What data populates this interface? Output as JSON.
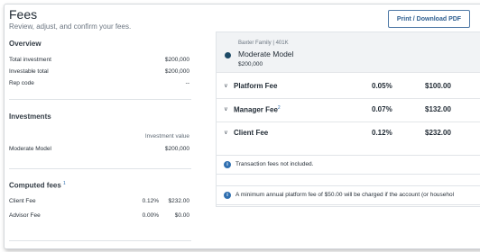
{
  "header": {
    "title": "Fees",
    "subtitle": "Review, adjust, and confirm your fees.",
    "print_label": "Print / Download PDF"
  },
  "overview": {
    "title": "Overview",
    "rows": [
      {
        "label": "Total investment",
        "value": "$200,000"
      },
      {
        "label": "Investable total",
        "value": "$200,000"
      },
      {
        "label": "Rep code",
        "value": "--"
      }
    ]
  },
  "investments": {
    "title": "Investments",
    "column_header": "Investment value",
    "rows": [
      {
        "label": "Moderate Model",
        "value": "$200,000"
      }
    ]
  },
  "computed_fees": {
    "title": "Computed fees",
    "footnote": "1",
    "rows": [
      {
        "label": "Client Fee",
        "pct": "0.12%",
        "value": "$232.00"
      },
      {
        "label": "Advisor Fee",
        "pct": "0.00%",
        "value": "$0.00"
      }
    ]
  },
  "model_card": {
    "account": "Baxter Family | 401K",
    "name": "Moderate Model",
    "amount": "$200,000",
    "dot_color": "#1d4a66",
    "fees": [
      {
        "name": "Platform Fee",
        "footnote": "",
        "pct": "0.05%",
        "amount": "$100.00"
      },
      {
        "name": "Manager Fee",
        "footnote": "2",
        "pct": "0.07%",
        "amount": "$132.00"
      },
      {
        "name": "Client Fee",
        "footnote": "",
        "pct": "0.12%",
        "amount": "$232.00"
      }
    ]
  },
  "notes": [
    {
      "icon": "info-icon",
      "text": "Transaction fees not included."
    },
    {
      "icon": "info-icon",
      "text": "A minimum annual platform fee of $50.00 will be charged if the account (or househol"
    }
  ],
  "colors": {
    "accent": "#2f6fb0",
    "button_text": "#2f5f91"
  }
}
